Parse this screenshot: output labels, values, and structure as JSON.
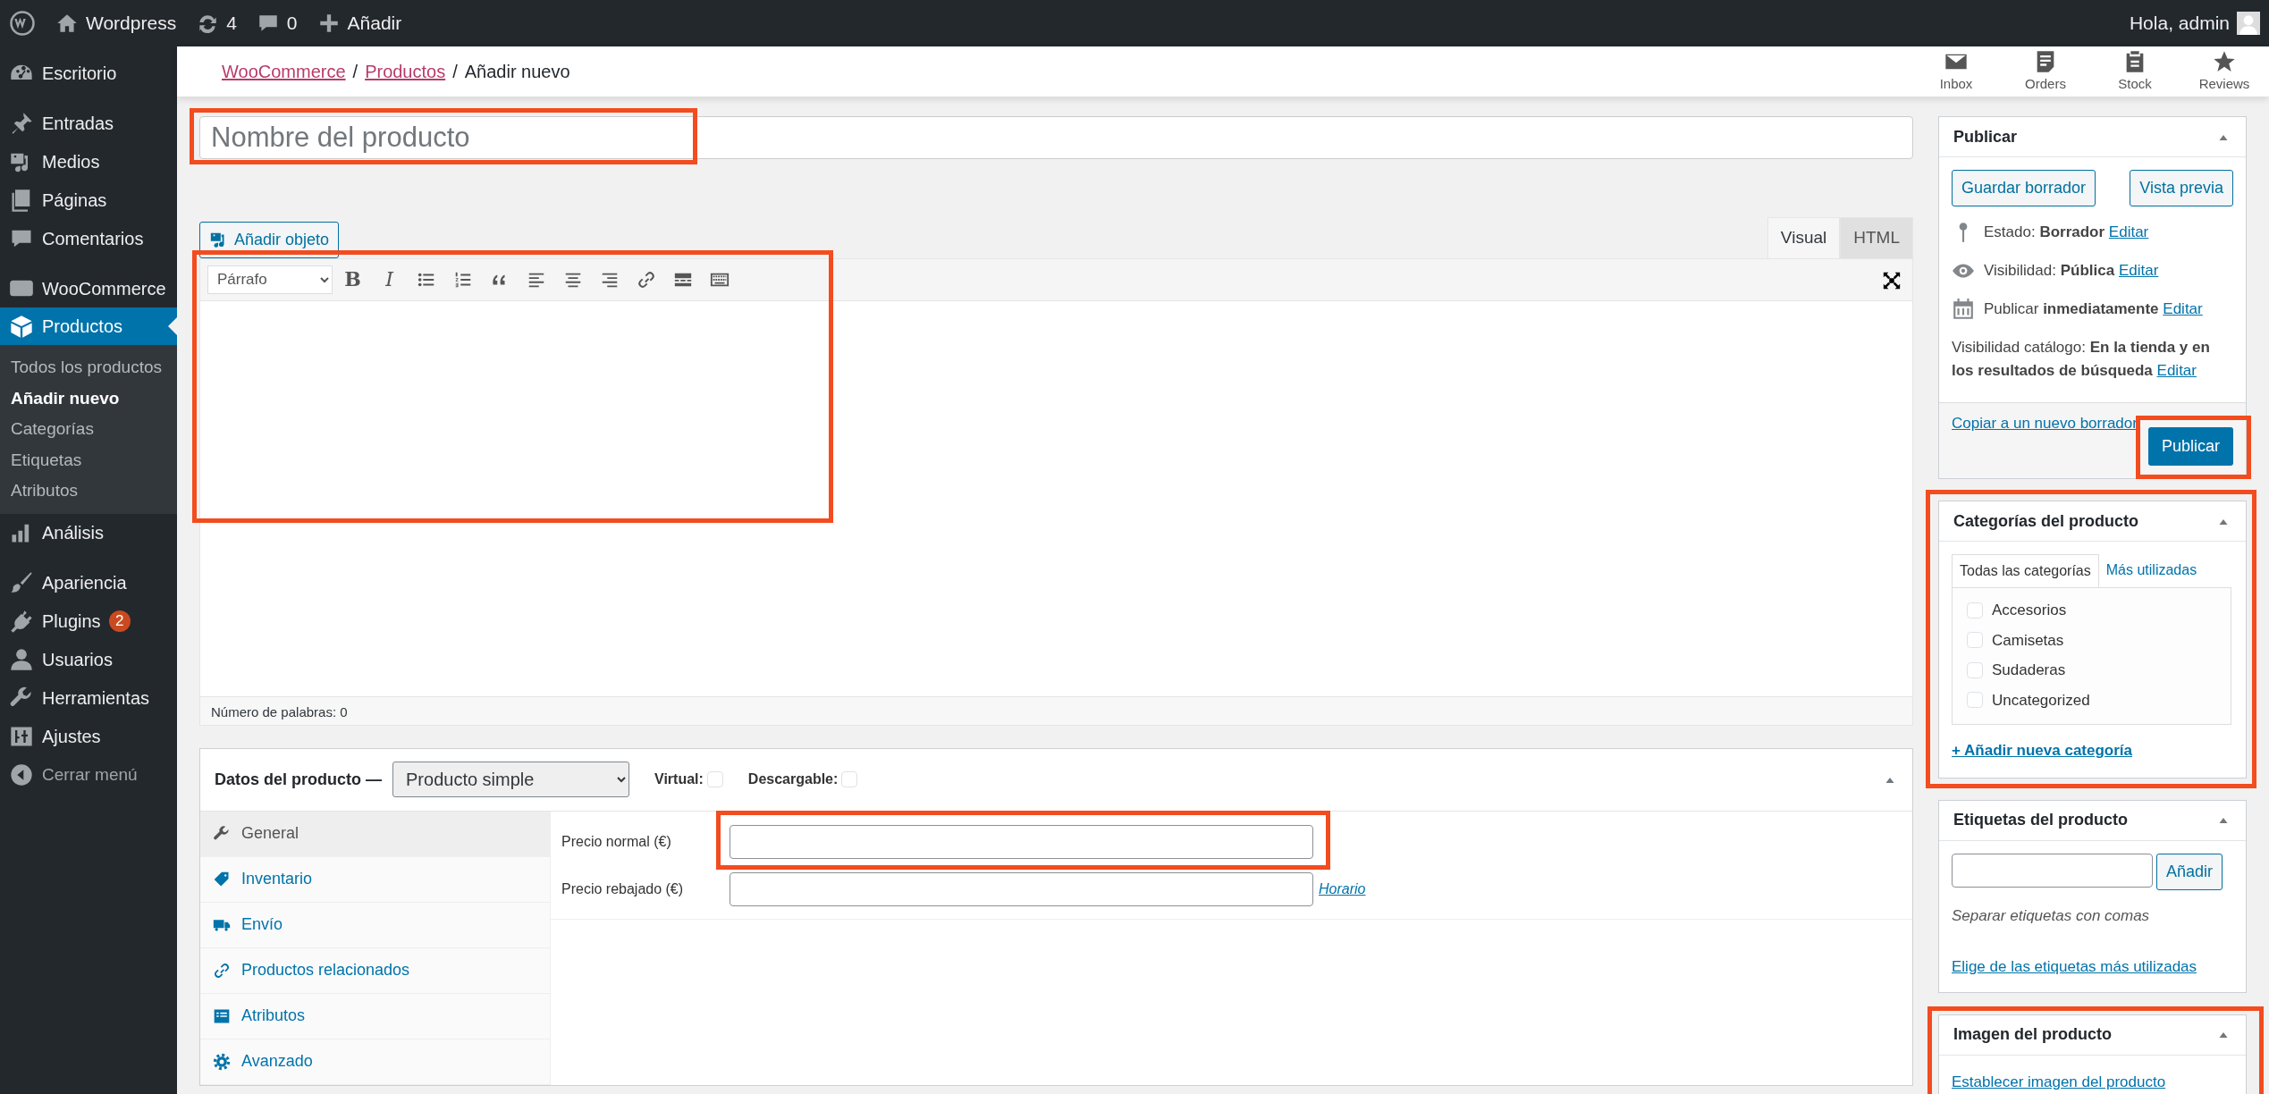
{
  "admin_bar": {
    "site": "Wordpress",
    "updates": "4",
    "comments": "0",
    "new": "Añadir",
    "greeting": "Hola, admin"
  },
  "sidebar": {
    "groups": [
      [
        {
          "kind": "dashboard",
          "label": "Escritorio",
          "selected": false
        }
      ],
      [
        {
          "kind": "pin",
          "label": "Entradas",
          "selected": false
        },
        {
          "kind": "media",
          "label": "Medios",
          "selected": false
        },
        {
          "kind": "pages",
          "label": "Páginas",
          "selected": false
        },
        {
          "kind": "comments",
          "label": "Comentarios",
          "selected": false
        }
      ],
      [
        {
          "kind": "woo",
          "label": "WooCommerce",
          "selected": false
        },
        {
          "kind": "box",
          "label": "Productos",
          "selected": true,
          "children": [
            {
              "label": "Todos los productos",
              "selected": false
            },
            {
              "label": "Añadir nuevo",
              "selected": true
            },
            {
              "label": "Categorías",
              "selected": false
            },
            {
              "label": "Etiquetas",
              "selected": false
            },
            {
              "label": "Atributos",
              "selected": false
            }
          ]
        },
        {
          "kind": "chart",
          "label": "Análisis",
          "selected": false
        }
      ],
      [
        {
          "kind": "brush",
          "label": "Apariencia",
          "selected": false
        },
        {
          "kind": "plug",
          "label": "Plugins",
          "selected": false,
          "badge": "2"
        },
        {
          "kind": "user",
          "label": "Usuarios",
          "selected": false
        },
        {
          "kind": "wrench",
          "label": "Herramientas",
          "selected": false
        },
        {
          "kind": "settings",
          "label": "Ajustes",
          "selected": false
        },
        {
          "kind": "collapse",
          "label": "Cerrar menú",
          "selected": false
        }
      ]
    ]
  },
  "header": {
    "breadcrumbs": [
      {
        "label": "WooCommerce",
        "link": true
      },
      {
        "label": "Productos",
        "link": true,
        "separator": "/"
      },
      {
        "label": "Añadir nuevo",
        "link": false,
        "separator": "/"
      }
    ],
    "activity": [
      {
        "kind": "inbox",
        "label": "Inbox"
      },
      {
        "kind": "orders",
        "label": "Orders"
      },
      {
        "kind": "stock",
        "label": "Stock"
      },
      {
        "kind": "reviews",
        "label": "Reviews"
      }
    ]
  },
  "title_field": {
    "placeholder": "Nombre del producto",
    "highlighted": true
  },
  "editor": {
    "add_media": "Añadir objeto",
    "highlighted": true,
    "tabs": [
      {
        "label": "Visual",
        "selected": true
      },
      {
        "label": "HTML",
        "selected": false
      }
    ],
    "format": "Párrafo",
    "toolbar": [
      {
        "kind": "bold",
        "label": "B"
      },
      {
        "kind": "italic",
        "label": "I"
      },
      {
        "kind": "bullets"
      },
      {
        "kind": "numbers"
      },
      {
        "kind": "quote"
      },
      {
        "kind": "align-left"
      },
      {
        "kind": "align-center"
      },
      {
        "kind": "align-right"
      },
      {
        "kind": "link"
      },
      {
        "kind": "more"
      },
      {
        "kind": "keyboard"
      }
    ],
    "word_count": "Número de palabras: 0"
  },
  "product_data": {
    "title": "Datos del producto —",
    "type": "Producto simple",
    "options": [
      {
        "label": "Virtual:",
        "checked": false
      },
      {
        "label": "Descargable:",
        "checked": false
      }
    ],
    "tabs": [
      {
        "kind": "wrench",
        "label": "General",
        "selected": true
      },
      {
        "kind": "tag",
        "label": "Inventario",
        "selected": false
      },
      {
        "kind": "truck",
        "label": "Envío",
        "selected": false
      },
      {
        "kind": "link",
        "label": "Productos relacionados",
        "selected": false
      },
      {
        "kind": "list",
        "label": "Atributos",
        "selected": false
      },
      {
        "kind": "gear",
        "label": "Avanzado",
        "selected": false
      }
    ],
    "fields": [
      {
        "label": "Precio normal (€)",
        "highlighted": true
      },
      {
        "label": "Precio rebajado (€)",
        "link": "Horario",
        "highlighted": false
      }
    ]
  },
  "publish": {
    "title": "Publicar",
    "save_draft": "Guardar borrador",
    "preview": "Vista previa",
    "rows": [
      {
        "kind": "status",
        "text": "Estado: **Borrador**",
        "link": "Editar"
      },
      {
        "kind": "visibility",
        "text": "Visibilidad: **Pública**",
        "link": "Editar"
      },
      {
        "kind": "schedule",
        "text": "Publicar **inmediatamente**",
        "link": "Editar"
      },
      {
        "kind": "catalog",
        "text": "Visibilidad catálogo: **En la tienda y en los resultados de búsqueda**",
        "link": "Editar"
      }
    ],
    "copy": "Copiar a un nuevo borrador",
    "button": "Publicar",
    "highlighted": true
  },
  "categories": {
    "title": "Categorías del producto",
    "highlighted": true,
    "tabs": [
      {
        "label": "Todas las categorías",
        "selected": true
      },
      {
        "label": "Más utilizadas",
        "selected": false
      }
    ],
    "items": [
      {
        "label": "Accesorios",
        "checked": false
      },
      {
        "label": "Camisetas",
        "checked": false
      },
      {
        "label": "Sudaderas",
        "checked": false
      },
      {
        "label": "Uncategorized",
        "checked": false
      }
    ],
    "add": "+ Añadir nueva categoría"
  },
  "tags": {
    "title": "Etiquetas del producto",
    "button": "Añadir",
    "hint": "Separar etiquetas con comas",
    "link": "Elige de las etiquetas más utilizadas"
  },
  "image": {
    "title": "Imagen del producto",
    "link": "Establecer imagen del producto",
    "highlighted": true
  }
}
